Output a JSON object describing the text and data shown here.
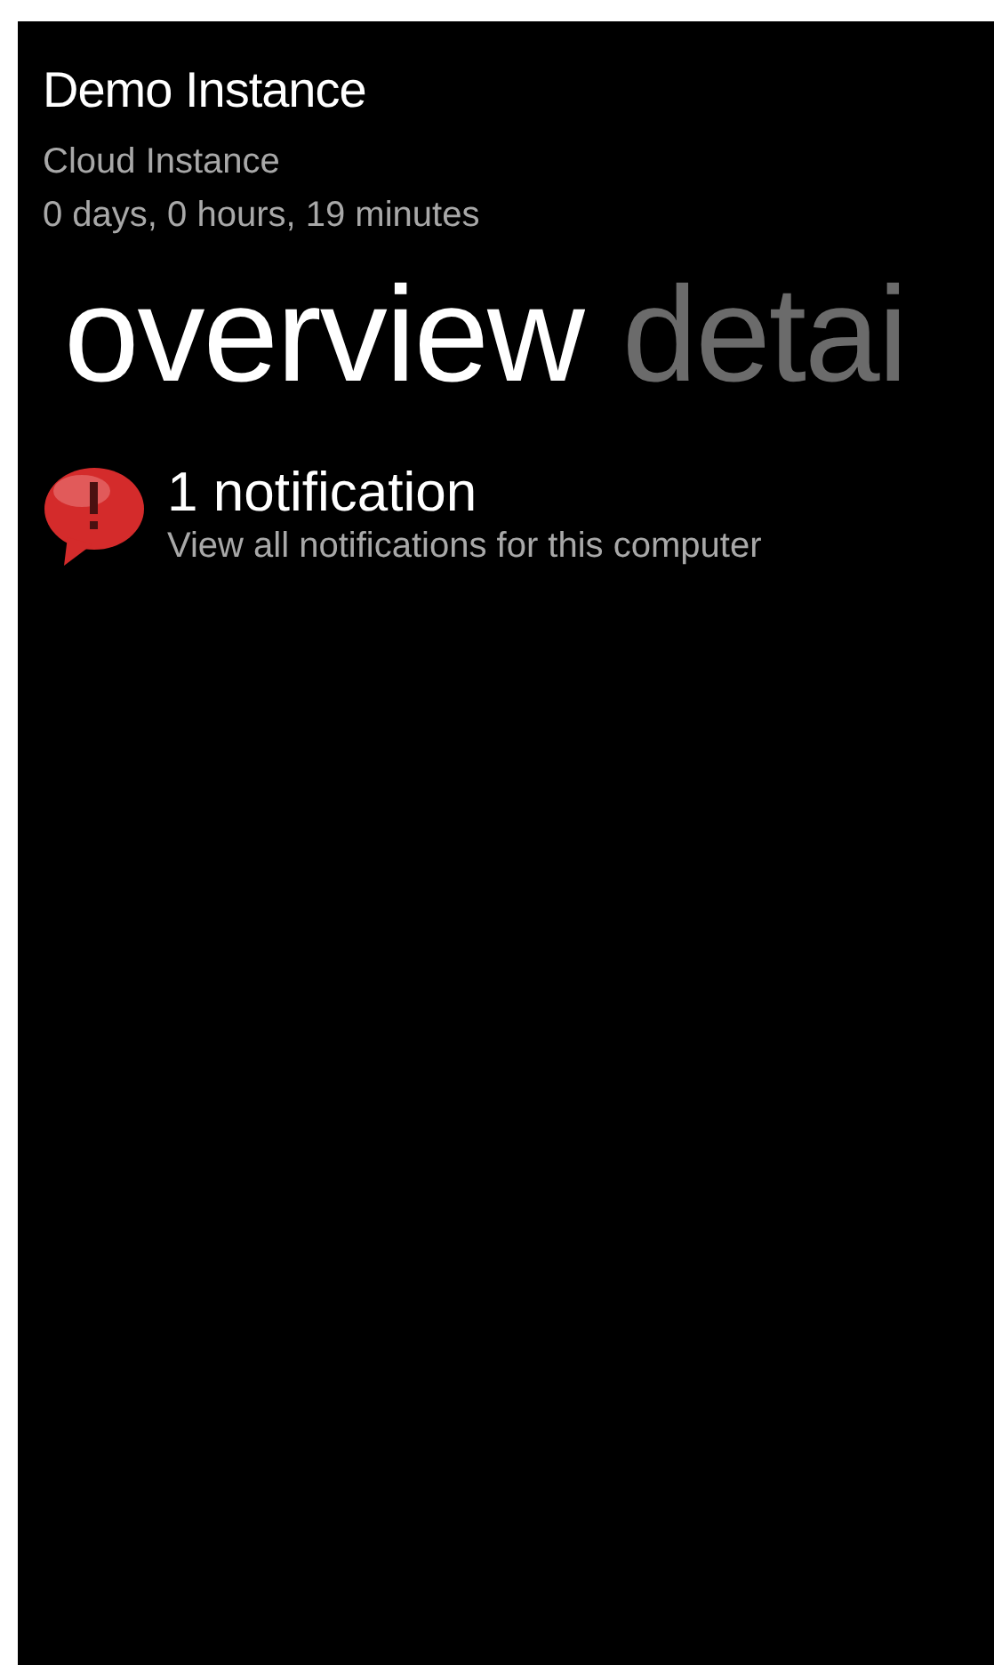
{
  "header": {
    "title": "Demo Instance",
    "subtitle": "Cloud Instance",
    "uptime": "0 days, 0 hours, 19 minutes"
  },
  "pivot": [
    {
      "label": "overview",
      "selected": true
    },
    {
      "label": "detai",
      "selected": false
    }
  ],
  "notifications": [
    {
      "title": "1 notification",
      "description": "View all notifications for this computer"
    }
  ]
}
